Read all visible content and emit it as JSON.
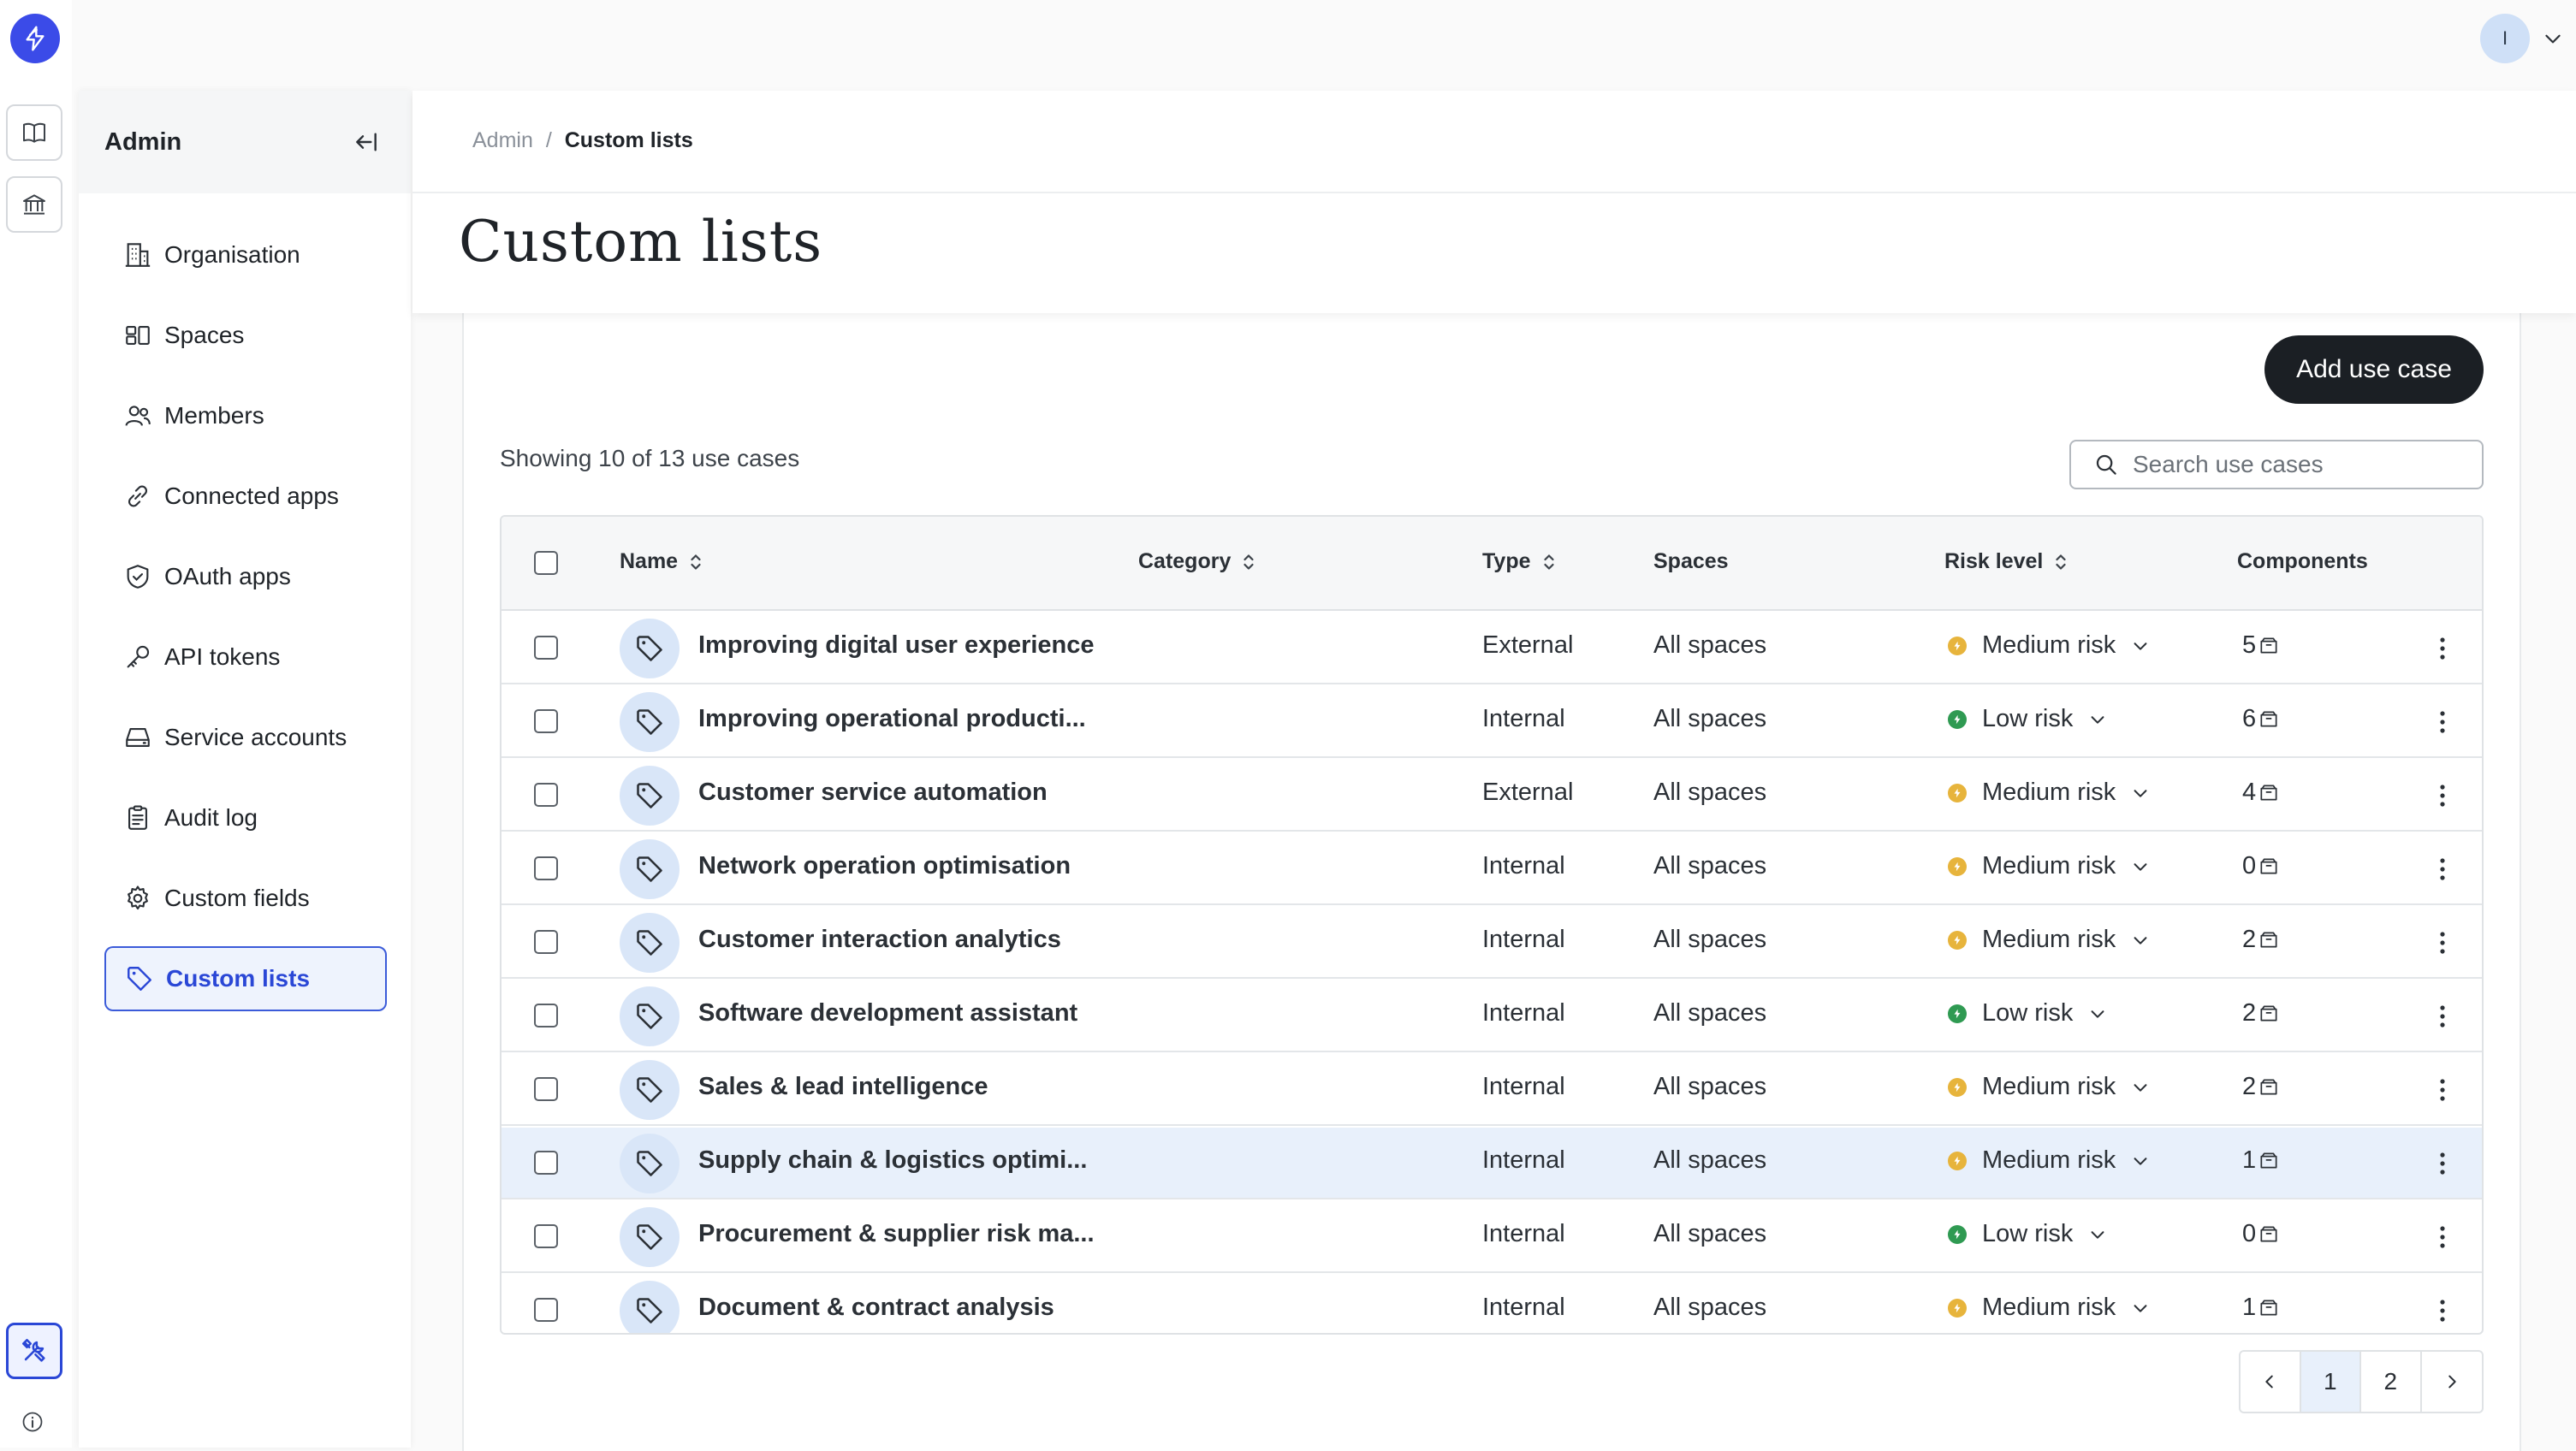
{
  "colors": {
    "accent": "#2a47d6",
    "medium_risk": "#e7b43c",
    "low_risk": "#2f9a52",
    "primary_button": "#1b1f24"
  },
  "user": {
    "avatar_initial": "I"
  },
  "admin": {
    "title": "Admin",
    "nav": [
      {
        "label": "Organisation",
        "icon": "building-icon"
      },
      {
        "label": "Spaces",
        "icon": "spaces-icon"
      },
      {
        "label": "Members",
        "icon": "members-icon"
      },
      {
        "label": "Connected apps",
        "icon": "link-icon"
      },
      {
        "label": "OAuth apps",
        "icon": "shield-icon"
      },
      {
        "label": "API tokens",
        "icon": "key-icon"
      },
      {
        "label": "Service accounts",
        "icon": "server-icon"
      },
      {
        "label": "Audit log",
        "icon": "clipboard-icon"
      },
      {
        "label": "Custom fields",
        "icon": "gear-icon"
      },
      {
        "label": "Custom lists",
        "icon": "tag-icon",
        "active": true
      }
    ]
  },
  "breadcrumb": {
    "parent": "Admin",
    "separator": "/",
    "current": "Custom lists"
  },
  "page": {
    "title": "Custom lists"
  },
  "toolbar": {
    "add_button": "Add use case",
    "showing": "Showing 10 of 13 use cases",
    "search_placeholder": "Search use cases"
  },
  "table": {
    "columns": {
      "name": "Name",
      "category": "Category",
      "type": "Type",
      "spaces": "Spaces",
      "risk": "Risk level",
      "components": "Components"
    },
    "rows": [
      {
        "name": "Improving digital user experience",
        "category": "",
        "type": "External",
        "spaces": "All spaces",
        "risk": "Medium risk",
        "risk_level": "medium",
        "components": "5"
      },
      {
        "name": "Improving operational producti...",
        "category": "",
        "type": "Internal",
        "spaces": "All spaces",
        "risk": "Low risk",
        "risk_level": "low",
        "components": "6"
      },
      {
        "name": "Customer service automation",
        "category": "",
        "type": "External",
        "spaces": "All spaces",
        "risk": "Medium risk",
        "risk_level": "medium",
        "components": "4"
      },
      {
        "name": "Network operation optimisation",
        "category": "",
        "type": "Internal",
        "spaces": "All spaces",
        "risk": "Medium risk",
        "risk_level": "medium",
        "components": "0"
      },
      {
        "name": "Customer interaction analytics",
        "category": "",
        "type": "Internal",
        "spaces": "All spaces",
        "risk": "Medium risk",
        "risk_level": "medium",
        "components": "2"
      },
      {
        "name": "Software development assistant",
        "category": "",
        "type": "Internal",
        "spaces": "All spaces",
        "risk": "Low risk",
        "risk_level": "low",
        "components": "2"
      },
      {
        "name": "Sales & lead intelligence",
        "category": "",
        "type": "Internal",
        "spaces": "All spaces",
        "risk": "Medium risk",
        "risk_level": "medium",
        "components": "2"
      },
      {
        "name": "Supply chain & logistics optimi...",
        "category": "",
        "type": "Internal",
        "spaces": "All spaces",
        "risk": "Medium risk",
        "risk_level": "medium",
        "components": "1",
        "highlighted": true
      },
      {
        "name": "Procurement & supplier risk ma...",
        "category": "",
        "type": "Internal",
        "spaces": "All spaces",
        "risk": "Low risk",
        "risk_level": "low",
        "components": "0"
      },
      {
        "name": "Document & contract analysis",
        "category": "",
        "type": "Internal",
        "spaces": "All spaces",
        "risk": "Medium risk",
        "risk_level": "medium",
        "components": "1"
      }
    ]
  },
  "pagination": {
    "pages": [
      "1",
      "2"
    ],
    "current": "1"
  }
}
